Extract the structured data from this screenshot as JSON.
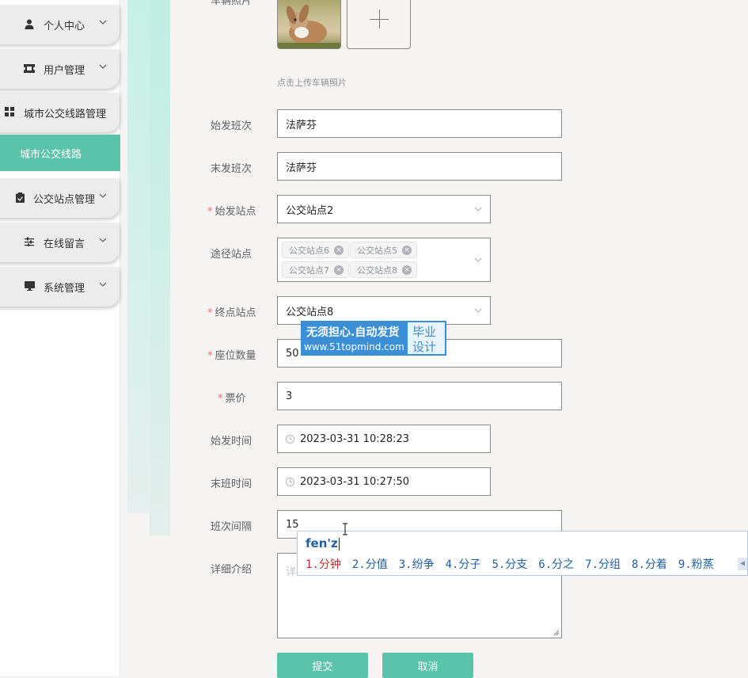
{
  "sidebar": {
    "items": [
      {
        "label": "个人中心",
        "icon": "person-icon",
        "has_chevron": true
      },
      {
        "label": "用户管理",
        "icon": "ticket-icon",
        "has_chevron": true
      },
      {
        "label": "城市公交线路管理",
        "icon": "grid-icon",
        "has_chevron": false
      },
      {
        "label": "公交站点管理",
        "icon": "clipboard-icon",
        "has_chevron": true
      },
      {
        "label": "在线留言",
        "icon": "sliders-icon",
        "has_chevron": true
      },
      {
        "label": "系统管理",
        "icon": "monitor-icon",
        "has_chevron": true
      }
    ],
    "active_subitem": "城市公交线路"
  },
  "form": {
    "photo_label": "车辆照片",
    "upload_hint": "点击上传车辆照片",
    "first_shift": {
      "label": "始发班次",
      "value": "法萨芬"
    },
    "last_shift": {
      "label": "末发班次",
      "value": "法萨芬"
    },
    "start_station": {
      "label": "始发站点",
      "value": "公交站点2",
      "required": true
    },
    "via_stations": {
      "label": "途径站点",
      "tags": [
        "公交站点6",
        "公交站点5",
        "公交站点7",
        "公交站点8"
      ]
    },
    "end_station": {
      "label": "终点站点",
      "value": "公交站点8",
      "required": true
    },
    "seats": {
      "label": "座位数量",
      "value": "50",
      "required": true
    },
    "fare": {
      "label": "票价",
      "value": "3",
      "required": true
    },
    "start_time": {
      "label": "始发时间",
      "value": "2023-03-31 10:28:23"
    },
    "end_time": {
      "label": "末班时间",
      "value": "2023-03-31 10:27:50"
    },
    "interval": {
      "label": "班次间隔",
      "value": "15"
    },
    "details": {
      "label": "详细介绍",
      "placeholder": "详"
    },
    "submit_label": "提交",
    "cancel_label": "取消"
  },
  "watermark": {
    "line1": "无须担心.自动发货",
    "line2": "www.51topmind.com",
    "right1": "毕业",
    "right2": "设计"
  },
  "ime": {
    "composition": "fen'z",
    "candidates": [
      "1.分钟",
      "2.分值",
      "3.纷争",
      "4.分子",
      "5.分支",
      "6.分之",
      "7.分组",
      "8.分着",
      "9.粉蒸"
    ]
  },
  "colors": {
    "accent": "#5cc3ab",
    "required": "#f56c6c",
    "ime_text": "#1f5fa3",
    "ime_first": "#c62b2b",
    "watermark_bg": "#3a8fd6"
  }
}
